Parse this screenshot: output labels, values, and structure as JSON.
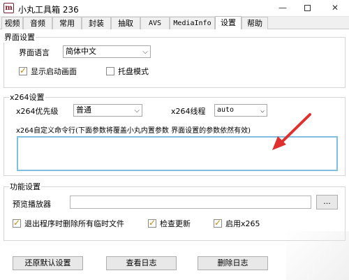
{
  "window": {
    "icon_letter": "m",
    "title": "小丸工具箱 236",
    "min_glyph": "—",
    "close_glyph": "✕"
  },
  "tabs": [
    {
      "label": "视频"
    },
    {
      "label": "音频"
    },
    {
      "label": "常用"
    },
    {
      "label": "封装"
    },
    {
      "label": "抽取"
    },
    {
      "label": "AVS"
    },
    {
      "label": "MediaInfo"
    },
    {
      "label": "设置",
      "active": true
    },
    {
      "label": "帮助"
    }
  ],
  "ui_settings": {
    "title": "界面设置",
    "language_label": "界面语言",
    "language_value": "简体中文",
    "show_splash_label": "显示启动画面",
    "show_splash_checked": true,
    "tray_mode_label": "托盘模式",
    "tray_mode_checked": false
  },
  "x264_settings": {
    "title": "x264设置",
    "priority_label": "x264优先级",
    "priority_value": "普通",
    "threads_label": "x264线程",
    "threads_value": "auto",
    "custom_cmd_label": "x264自定义命令行(下面参数将覆盖小丸内置参数 界面设置的参数依然有效)",
    "custom_cmd_value": ""
  },
  "func_settings": {
    "title": "功能设置",
    "player_label": "预览播放器",
    "player_value": "",
    "browse_label": "...",
    "delete_temp_label": "退出程序时删除所有临时文件",
    "delete_temp_checked": true,
    "check_update_label": "检查更新",
    "check_update_checked": true,
    "enable_x265_label": "启用x265",
    "enable_x265_checked": true
  },
  "buttons": {
    "restore_default": "还原默认设置",
    "view_log": "查看日志",
    "delete_log": "删除日志"
  },
  "colors": {
    "annotation_arrow": "#e0302e",
    "focus_border": "#7fbfe0",
    "checkmark": "#c8860a"
  }
}
